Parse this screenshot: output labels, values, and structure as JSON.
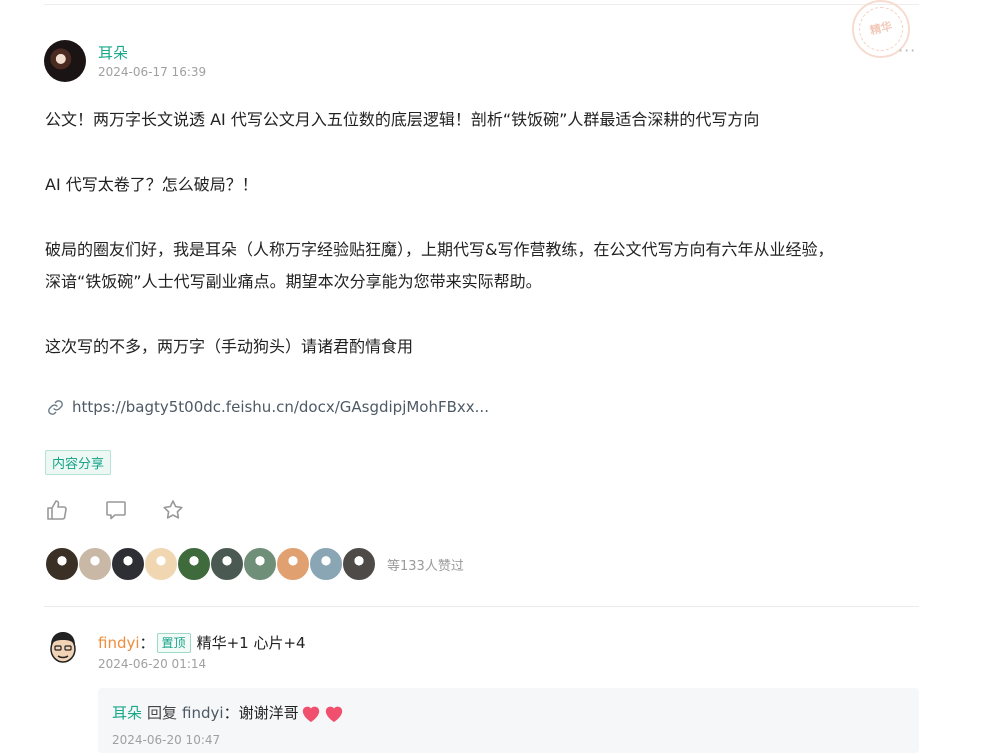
{
  "post": {
    "author": "耳朵",
    "time": "2024-06-17 16:39",
    "paragraphs": [
      "公文！两万字长文说透 AI 代写公文月入五位数的底层逻辑！剖析“铁饭碗”人群最适合深耕的代写方向",
      "AI 代写太卷了？怎么破局？！",
      "破局的圈友们好，我是耳朵（人称万字经验贴狂魔），上期代写&写作营教练，在公文代写方向有六年从业经验，",
      "深谙“铁饭碗”人士代写副业痛点。期望本次分享能为您带来实际帮助。",
      "这次写的不多，两万字（手动狗头）请诸君酌情食用"
    ],
    "link_text": "https://bagty5t00dc.feishu.cn/docx/GAsgdipjMohFBxx...",
    "tag": "内容分享",
    "stamp_text": "精华",
    "more_glyph": "···",
    "likes_text": "等133人赞过",
    "like_avatar_colors": [
      "#3a3026",
      "#c9b8a6",
      "#2d2f35",
      "#f0d7b2",
      "#3f6b3c",
      "#4a5a52",
      "#6f8f78",
      "#e0a070",
      "#8aa6b4",
      "#4e4a48"
    ]
  },
  "comment": {
    "author": "findyi",
    "colon": "：",
    "badge": "置顶",
    "text": "精华+1 心片+4",
    "time": "2024-06-20 01:14",
    "reply": {
      "author": "耳朵",
      "word": "回复",
      "target": "findyi",
      "colon": "：",
      "text": "谢谢洋哥",
      "time": "2024-06-20 10:47"
    }
  },
  "colors": {
    "accent_green": "#1aa88a",
    "accent_orange": "#f08c3a",
    "heart": "#f0506e"
  }
}
